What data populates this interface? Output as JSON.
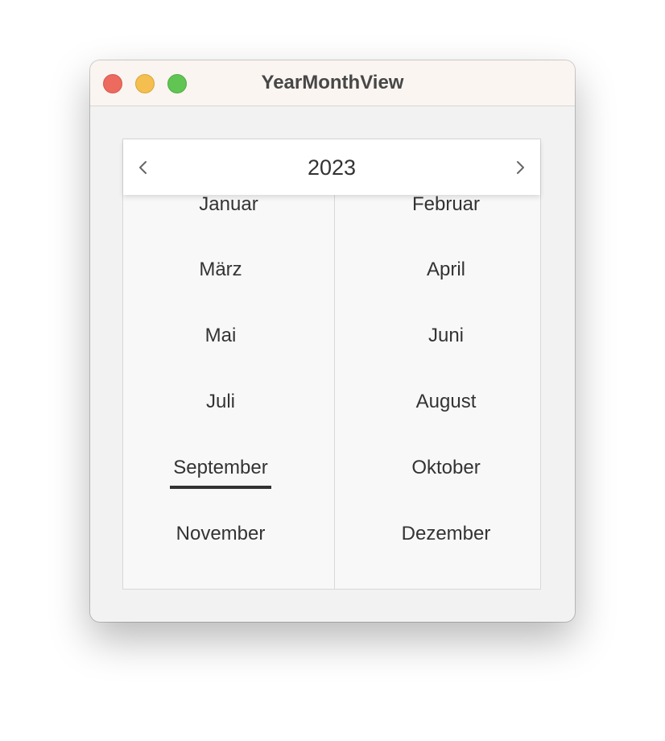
{
  "window": {
    "title": "YearMonthView"
  },
  "picker": {
    "year": "2023",
    "selected_month": "September",
    "months": [
      "Januar",
      "Februar",
      "März",
      "April",
      "Mai",
      "Juni",
      "Juli",
      "August",
      "September",
      "Oktober",
      "November",
      "Dezember"
    ]
  },
  "icons": {
    "prev": "chevron-left-icon",
    "next": "chevron-right-icon"
  }
}
